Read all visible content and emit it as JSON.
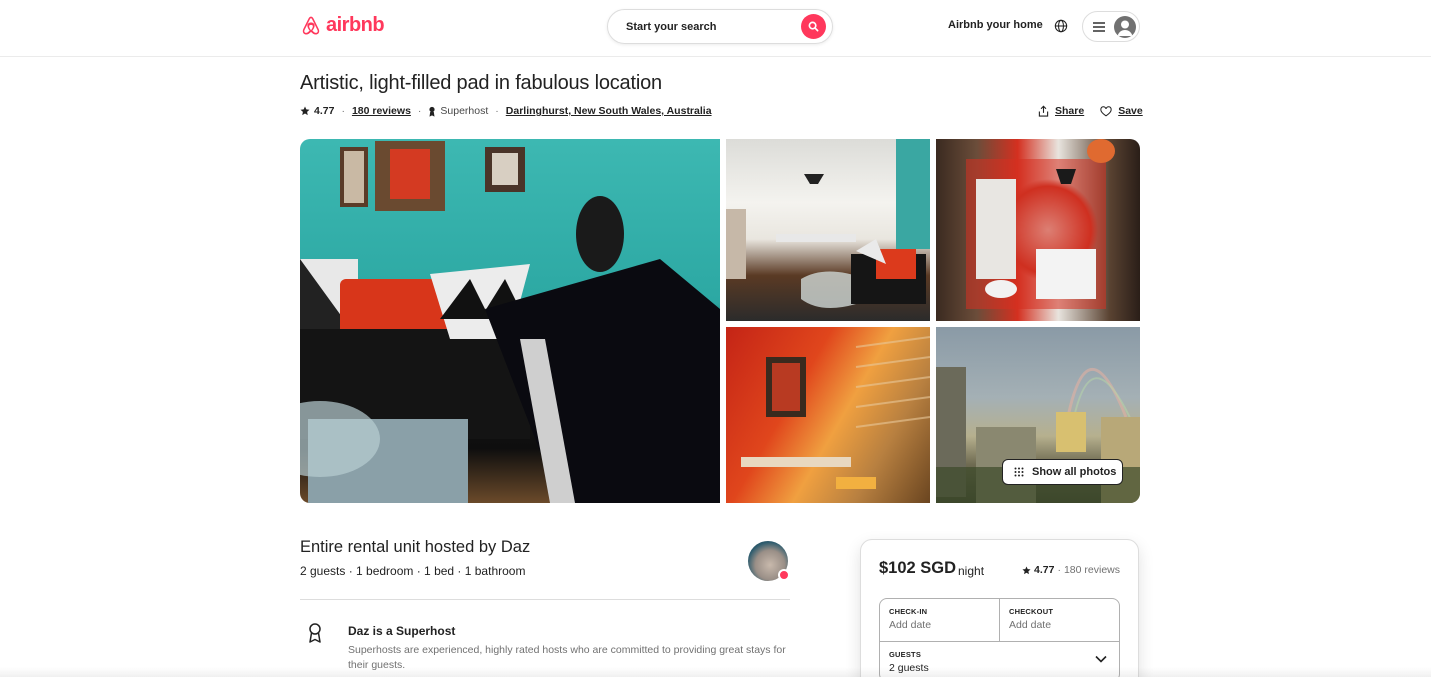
{
  "header": {
    "logo_text": "airbnb",
    "search_label": "Start your search",
    "host_link": "Airbnb your home"
  },
  "listing": {
    "title": "Artistic, light-filled pad in fabulous location",
    "rating": "4.77",
    "reviews": "180 reviews",
    "superhost": "Superhost",
    "location": "Darlinghurst, New South Wales, Australia",
    "share": "Share",
    "save": "Save",
    "show_all_photos": "Show all photos"
  },
  "host": {
    "title": "Entire rental unit hosted by Daz",
    "subtitle": "2 guests · 1 bedroom · 1 bed · 1 bathroom",
    "superhost_title": "Daz is a Superhost",
    "superhost_desc": "Superhosts are experienced, highly rated hosts who are committed to providing great stays for their guests."
  },
  "booking": {
    "price": "$102 SGD",
    "price_unit": "night",
    "rating": "4.77",
    "reviews": "180 reviews",
    "checkin_label": "CHECK-IN",
    "checkin_value": "Add date",
    "checkout_label": "CHECKOUT",
    "checkout_value": "Add date",
    "guests_label": "GUESTS",
    "guests_value": "2 guests"
  },
  "colors": {
    "brand": "#ff385c",
    "text": "#222222",
    "muted": "#717171",
    "border": "#dddddd"
  }
}
